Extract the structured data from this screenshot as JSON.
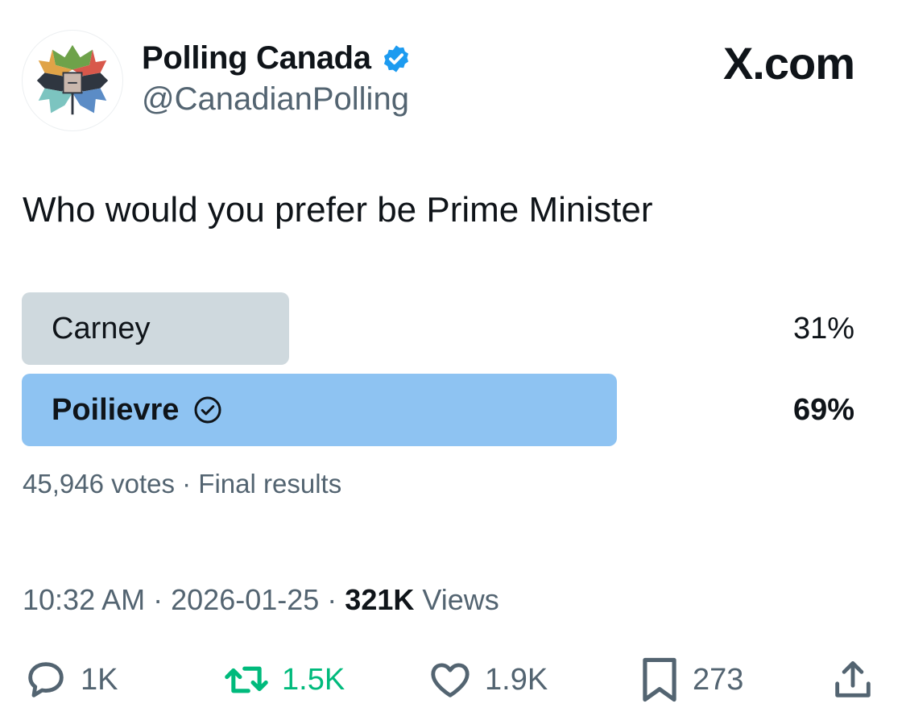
{
  "account": {
    "display_name": "Polling Canada",
    "handle": "@CanadianPolling",
    "verified_icon": "verified-badge-icon",
    "avatar_icon": "maple-leaf-ballot-logo"
  },
  "brand": {
    "watermark": "X.com"
  },
  "tweet": {
    "text": "Who would you prefer be Prime Minister"
  },
  "poll": {
    "options": [
      {
        "label": "Carney",
        "percent_text": "31%",
        "percent": 31,
        "winner": false
      },
      {
        "label": "Poilievre",
        "percent_text": "69%",
        "percent": 69,
        "winner": true,
        "winner_icon": "check-circle-icon"
      }
    ],
    "meta": "45,946 votes · Final results"
  },
  "timestamp": {
    "time": "10:32 AM",
    "date": "2026-01-25",
    "views_count": "321K",
    "views_label": "Views"
  },
  "actions": {
    "reply_count": "1K",
    "retweet_count": "1.5K",
    "like_count": "1.9K",
    "bookmark_count": "273"
  },
  "colors": {
    "winner_bar": "#8ec3f2",
    "loser_bar": "#cfd9de",
    "verified": "#1d9bf0",
    "retweet": "#00ba7c",
    "secondary_text": "#536471"
  }
}
